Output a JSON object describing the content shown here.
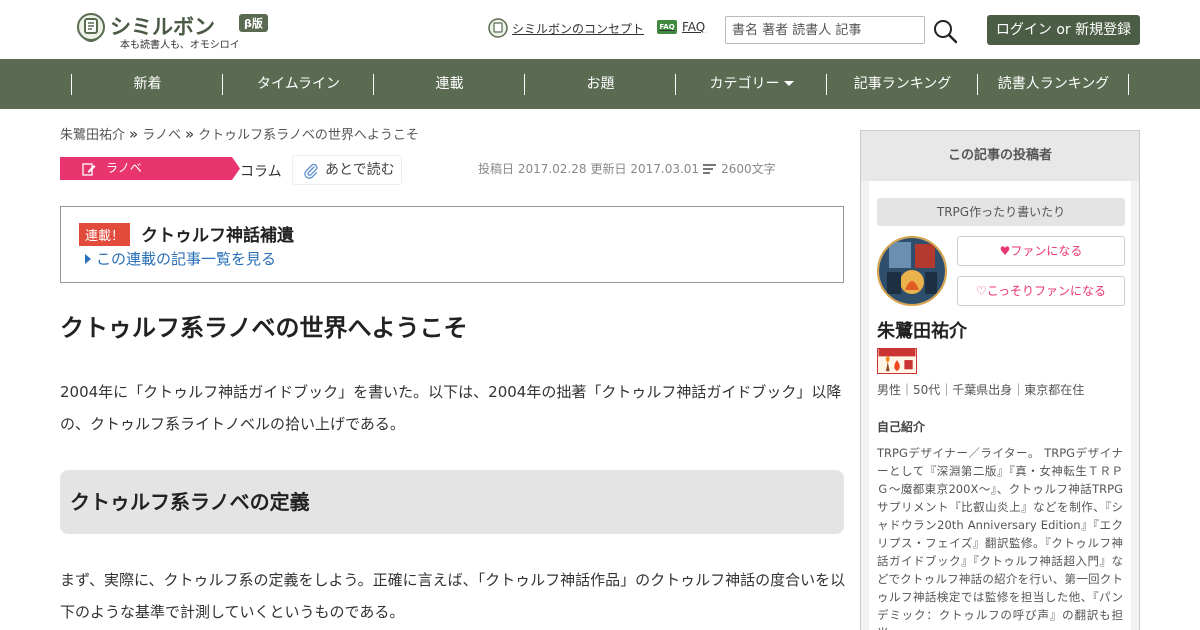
{
  "header": {
    "logo_name": "シミルボン",
    "logo_badge": "β版",
    "logo_tagline": "本も読書人も、オモシロイ",
    "concept_link": "シミルボンのコンセプト",
    "faq_icon_text": "FAQ",
    "faq_link": "FAQ",
    "search_placeholder": "書名 著者 読書人 記事",
    "login_button": "ログイン or 新規登録"
  },
  "nav": {
    "items": [
      {
        "label": "新着"
      },
      {
        "label": "タイムライン"
      },
      {
        "label": "連載"
      },
      {
        "label": "お題"
      },
      {
        "label": "カテゴリー"
      },
      {
        "label": "記事ランキング"
      },
      {
        "label": "読書人ランキング"
      }
    ]
  },
  "breadcrumb": {
    "items": [
      "朱鷺田祐介",
      "ラノベ",
      "クトゥルフ系ラノベの世界へようこそ"
    ],
    "separator": "»"
  },
  "article": {
    "category_tag": "ラノベ",
    "type_tag": "コラム",
    "read_later": "あとで読む",
    "posted": "投稿日 2017.02.28",
    "updated": "更新日 2017.03.01",
    "char_count": "2600文字",
    "series": {
      "badge": "連載！",
      "title": "クトゥルフ神話補遺",
      "link": "この連載の記事一覧を見る"
    },
    "title": "クトゥルフ系ラノベの世界へようこそ",
    "paragraph1": "2004年に「クトゥルフ神話ガイドブック」を書いた。以下は、2004年の拙著「クトゥルフ神話ガイドブック」以降の、クトゥルフ系ライトノベルの拾い上げである。",
    "section_heading": "クトゥルフ系ラノベの定義",
    "paragraph2": "まず、実際に、クトゥルフ系の定義をしよう。正確に言えば、「クトゥルフ神話作品」のクトゥルフ神話の度合いを以下のような基準で計測していくというものである。"
  },
  "sidebar": {
    "title": "この記事の投稿者",
    "catchphrase": "TRPG作ったり書いたり",
    "fan_button": "ファンになる",
    "secret_fan_button": "こっそりファンになる",
    "author_name": "朱鷺田祐介",
    "badge_label": "タイマツ by 10",
    "profile": "男性｜50代｜千葉県出身｜東京都在住",
    "bio_label": "自己紹介",
    "bio": "TRPGデザイナー／ライター。 TRPGデザイナーとして『深淵第二版』『真・女神転生ＴＲＰＧ～魔都東京200X～』、クトゥルフ神話TRPGサプリメント『比叡山炎上』などを制作、『シャドウラン20th Anniversary Edition』『エクリプス・フェイズ』翻訳監修。『クトゥルフ神話ガイドブック』『クトゥルフ神話超入門』などでクトゥルフ神話の紹介を行い、第一回クトゥルフ神話検定では監修を担当した他、『パンデミック：クトゥルフの呼び声』の翻訳も担当。"
  },
  "colors": {
    "brand_green": "#5a6b52",
    "category_pink": "#e9356f",
    "series_red": "#e24a3b",
    "link_blue": "#2a6fb7"
  }
}
